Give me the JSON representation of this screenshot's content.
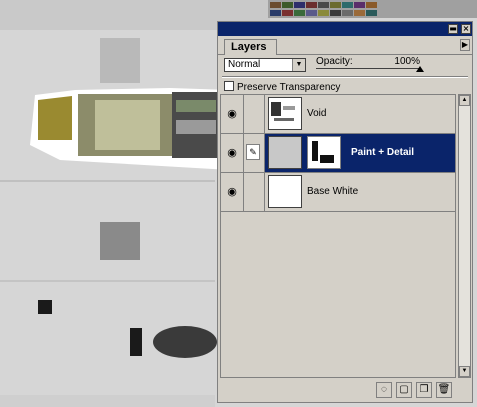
{
  "palette": {
    "colors": [
      "#6b4c2e",
      "#3c5a2a",
      "#2e2e6b",
      "#6b2e2e",
      "#4a4a4a",
      "#6b6b2e",
      "#2e6b6b",
      "#5a2e6b",
      "#8a5a2a",
      "#2a3c6a",
      "#7a3030",
      "#3a6a3a",
      "#5a5a8a",
      "#8a8a3a",
      "#3a3a3a",
      "#6a6a6a",
      "#9a6a3a",
      "#2a5a5a"
    ]
  },
  "panel": {
    "tab_label": "Layers",
    "blend_mode": "Normal",
    "opacity_label": "Opacity:",
    "opacity_value": "100%",
    "opacity_fraction": 1.0,
    "preserve_transparency_label": "Preserve Transparency",
    "layers": [
      {
        "name": "Void",
        "selected": false
      },
      {
        "name": "Paint + Detail",
        "selected": true
      },
      {
        "name": "Base White",
        "selected": false
      }
    ]
  },
  "icons": {
    "eye": "eye-icon",
    "brush": "paintbrush-icon",
    "menu": "panel-menu-arrow-icon",
    "minimize": "minimize-icon",
    "close": "close-icon",
    "new_set": "new-layer-set-icon",
    "new_layer": "new-layer-icon",
    "trash": "trash-icon",
    "mask": "layer-mask-icon"
  },
  "colors": {
    "titlebar": "#0a246a",
    "selection": "#0a246a",
    "panel_bg": "#d4d0c8"
  }
}
